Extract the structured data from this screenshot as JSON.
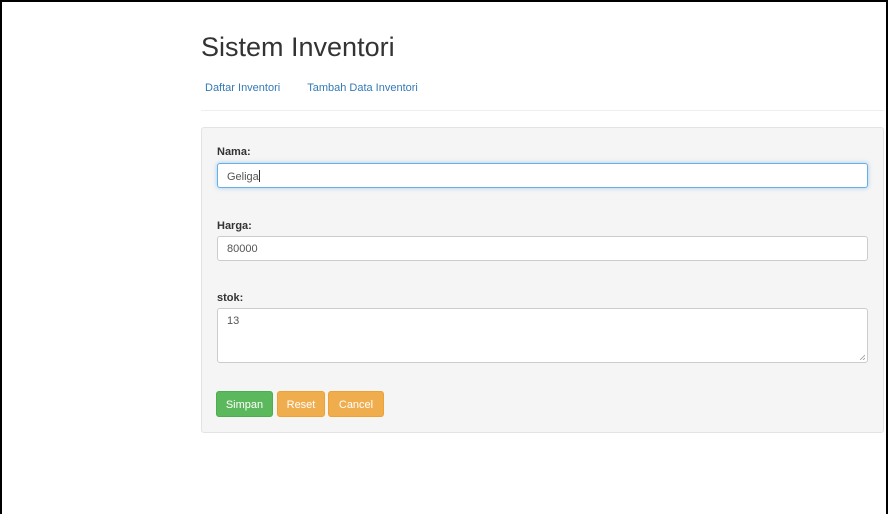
{
  "header": {
    "title": "Sistem Inventori"
  },
  "nav": {
    "items": [
      {
        "label": "Daftar Inventori"
      },
      {
        "label": "Tambah Data Inventori"
      }
    ]
  },
  "form": {
    "nama": {
      "label": "Nama:",
      "value": "Geliga"
    },
    "harga": {
      "label": "Harga:",
      "value": "80000"
    },
    "stok": {
      "label": "stok:",
      "value": "13"
    }
  },
  "buttons": {
    "simpan": "Simpan",
    "reset": "Reset",
    "cancel": "Cancel"
  },
  "colors": {
    "success": "#5cb85c",
    "warning": "#f0ad4e",
    "link": "#337ab7"
  }
}
